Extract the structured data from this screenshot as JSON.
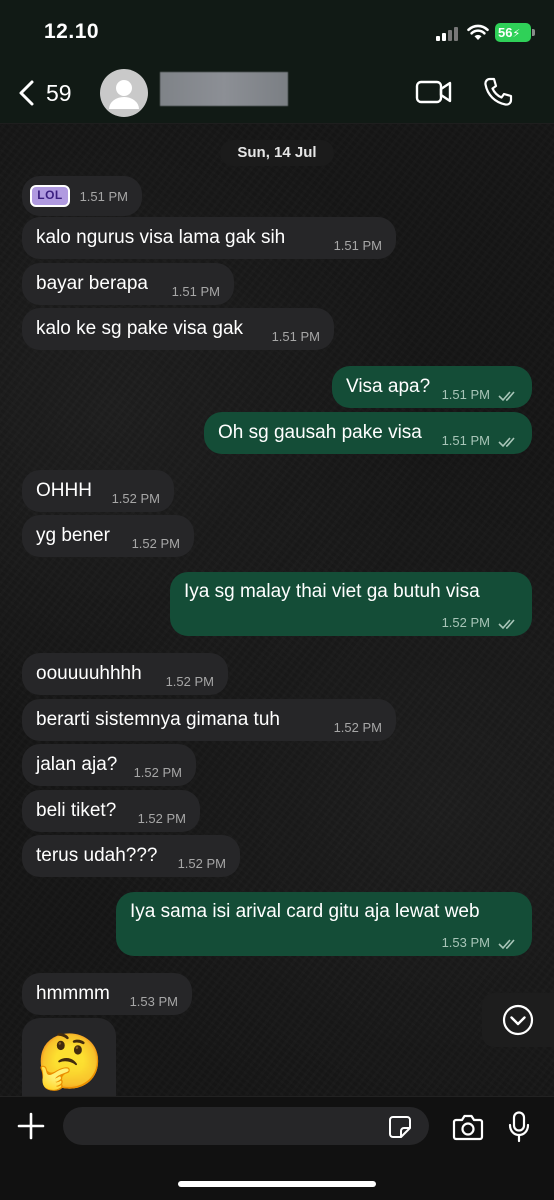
{
  "status_bar": {
    "time": "12.10",
    "battery": "56"
  },
  "header": {
    "back_count": "59"
  },
  "chat": {
    "date_label": "Sun, 14 Jul",
    "sticker": {
      "text": "LOL",
      "time": "1.51 PM"
    },
    "messages": [
      {
        "text": "kalo ngurus visa lama gak sih",
        "time": "1.51 PM",
        "direction": "in"
      },
      {
        "text": "bayar berapa",
        "time": "1.51 PM",
        "direction": "in"
      },
      {
        "text": "kalo ke sg pake visa gak",
        "time": "1.51 PM",
        "direction": "in"
      },
      {
        "text": "Visa apa?",
        "time": "1.51 PM",
        "direction": "out"
      },
      {
        "text": "Oh sg gausah pake visa",
        "time": "1.51 PM",
        "direction": "out"
      },
      {
        "text": "OHHH",
        "time": "1.52 PM",
        "direction": "in"
      },
      {
        "text": "yg bener",
        "time": "1.52 PM",
        "direction": "in"
      },
      {
        "text": "Iya sg malay thai viet ga butuh visa",
        "time": "1.52 PM",
        "direction": "out"
      },
      {
        "text": "oouuuuhhhh",
        "time": "1.52 PM",
        "direction": "in"
      },
      {
        "text": "berarti sistemnya gimana tuh",
        "time": "1.52 PM",
        "direction": "in"
      },
      {
        "text": "jalan aja?",
        "time": "1.52 PM",
        "direction": "in"
      },
      {
        "text": "beli tiket?",
        "time": "1.52 PM",
        "direction": "in"
      },
      {
        "text": "terus udah???",
        "time": "1.52 PM",
        "direction": "in"
      },
      {
        "text": "Iya sama isi arival card gitu aja lewat web",
        "time": "1.53 PM",
        "direction": "out"
      },
      {
        "text": "hmmmm",
        "time": "1.53 PM",
        "direction": "in"
      }
    ],
    "last_emoji": "🤔"
  },
  "input": {
    "placeholder": ""
  },
  "icons": {
    "back": "chevron-left-icon",
    "video": "video-camera-icon",
    "call": "phone-icon",
    "scroll": "chevron-down-circle-icon",
    "plus": "plus-icon",
    "sticker": "sticker-icon",
    "camera": "camera-icon",
    "mic": "microphone-icon"
  },
  "colors": {
    "incoming_bubble": "#262628",
    "outgoing_bubble": "#144d37",
    "battery": "#2fd158"
  }
}
